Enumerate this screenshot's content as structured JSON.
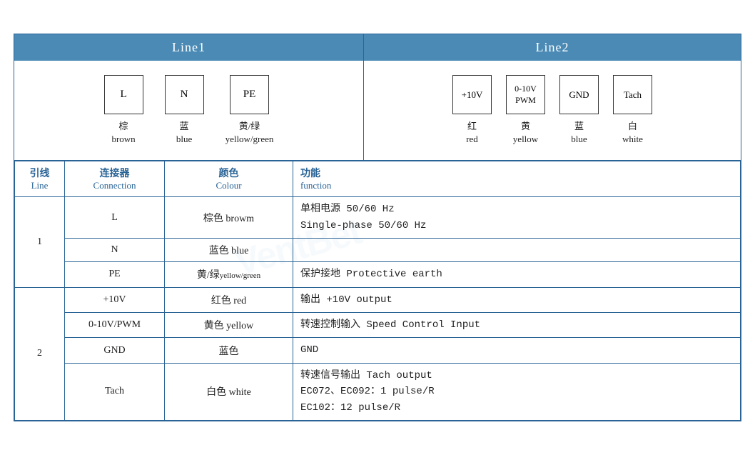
{
  "header": {
    "line1": "Line1",
    "line2": "Line2"
  },
  "diagram": {
    "line1": {
      "connectors": [
        {
          "label": "L",
          "color_zh": "棕",
          "color_en": "brown"
        },
        {
          "label": "N",
          "color_zh": "蓝",
          "color_en": "blue"
        },
        {
          "label": "PE",
          "color_zh": "黄/绿",
          "color_en": "yellow/green"
        }
      ]
    },
    "line2": {
      "connectors": [
        {
          "label": "+10V",
          "color_zh": "红",
          "color_en": "red"
        },
        {
          "label": "0-10V\nPWM",
          "color_zh": "黄",
          "color_en": "yellow"
        },
        {
          "label": "GND",
          "color_zh": "蓝",
          "color_en": "blue"
        },
        {
          "label": "Tach",
          "color_zh": "白",
          "color_en": "white"
        }
      ]
    }
  },
  "table": {
    "headers": {
      "line_zh": "引线",
      "line_en": "Line",
      "conn_zh": "连接器",
      "conn_en": "Connection",
      "color_zh": "颜色",
      "color_en": "Colour",
      "func_zh": "功能",
      "func_en": "function"
    },
    "rows": [
      {
        "line": "1",
        "rowspan": 3,
        "sub_rows": [
          {
            "connector": "L",
            "color": "棕色 browm",
            "function": "单相电源 50/60 Hz\nSingle-phase 50/60 Hz"
          },
          {
            "connector": "N",
            "color": "蓝色 blue",
            "function": ""
          },
          {
            "connector": "PE",
            "color": "黄/绿yellow/green",
            "function": "保护接地 Protective earth"
          }
        ]
      },
      {
        "line": "2",
        "rowspan": 4,
        "sub_rows": [
          {
            "connector": "+10V",
            "color": "红色 red",
            "function": "输出 +10V output"
          },
          {
            "connector": "0-10V/PWM",
            "color": "黄色 yellow",
            "function": "转速控制输入 Speed Control Input"
          },
          {
            "connector": "GND",
            "color": "蓝色",
            "function": "GND"
          },
          {
            "connector": "Tach",
            "color": "白色 white",
            "function": "转速信号输出 Tach output\nEC072、EC092：1 pulse/R\nEC102：12 pulse/R"
          }
        ]
      }
    ]
  }
}
